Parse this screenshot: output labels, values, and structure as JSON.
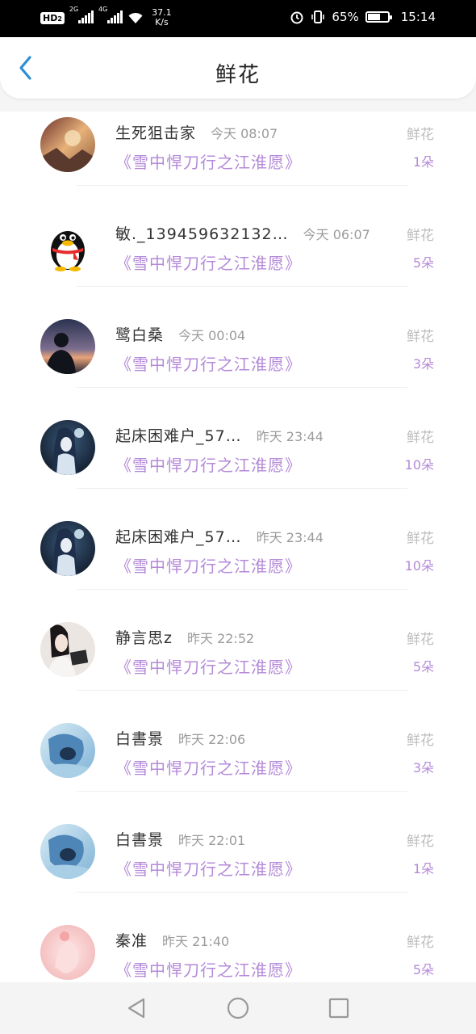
{
  "status_bar": {
    "hd": "HD",
    "hd_sub": "2",
    "net1": "2G",
    "net2": "4G",
    "speed_value": "37.1",
    "speed_unit": "K/s",
    "battery_percent": "65%",
    "battery_level": 0.65,
    "time": "15:14",
    "icons": [
      "alarm-icon",
      "vibrate-icon",
      "battery-icon",
      "wifi-icon",
      "signal-icon"
    ]
  },
  "header": {
    "title": "鲜花",
    "back_icon": "chevron-left-icon",
    "accent_color": "#2b8fd6"
  },
  "colors": {
    "book_title": "#b48ad8",
    "gift_type": "#bdbdbd",
    "time": "#9b9b9b"
  },
  "items": [
    {
      "name": "生死狙击家",
      "time": "今天 08:07",
      "book": "《雪中悍刀行之江淮愿》",
      "gift": "鲜花",
      "count": "1朵",
      "avatar": "fantasy-art"
    },
    {
      "name": "敏._139459632132…",
      "time": "今天 06:07",
      "book": "《雪中悍刀行之江淮愿》",
      "gift": "鲜花",
      "count": "5朵",
      "avatar": "qq-penguin"
    },
    {
      "name": "鹭白桑",
      "time": "今天 00:04",
      "book": "《雪中悍刀行之江淮愿》",
      "gift": "鲜花",
      "count": "3朵",
      "avatar": "sunset-silhouette"
    },
    {
      "name": "起床困难户_57…",
      "time": "昨天 23:44",
      "book": "《雪中悍刀行之江淮愿》",
      "gift": "鲜花",
      "count": "10朵",
      "avatar": "anime-night"
    },
    {
      "name": "起床困难户_57…",
      "time": "昨天 23:44",
      "book": "《雪中悍刀行之江淮愿》",
      "gift": "鲜花",
      "count": "10朵",
      "avatar": "anime-night"
    },
    {
      "name": "静言思z",
      "time": "昨天 22:52",
      "book": "《雪中悍刀行之江淮愿》",
      "gift": "鲜花",
      "count": "5朵",
      "avatar": "portrait-girl"
    },
    {
      "name": "白書景",
      "time": "昨天 22:06",
      "book": "《雪中悍刀行之江淮愿》",
      "gift": "鲜花",
      "count": "3朵",
      "avatar": "anime-blue"
    },
    {
      "name": "白書景",
      "time": "昨天 22:01",
      "book": "《雪中悍刀行之江淮愿》",
      "gift": "鲜花",
      "count": "1朵",
      "avatar": "anime-blue"
    },
    {
      "name": "秦准",
      "time": "昨天 21:40",
      "book": "《雪中悍刀行之江淮愿》",
      "gift": "鲜花",
      "count": "5朵",
      "avatar": "pink-hand"
    }
  ],
  "nav": {
    "back_icon": "triangle-back-icon",
    "home_icon": "circle-home-icon",
    "recents_icon": "square-recents-icon"
  }
}
